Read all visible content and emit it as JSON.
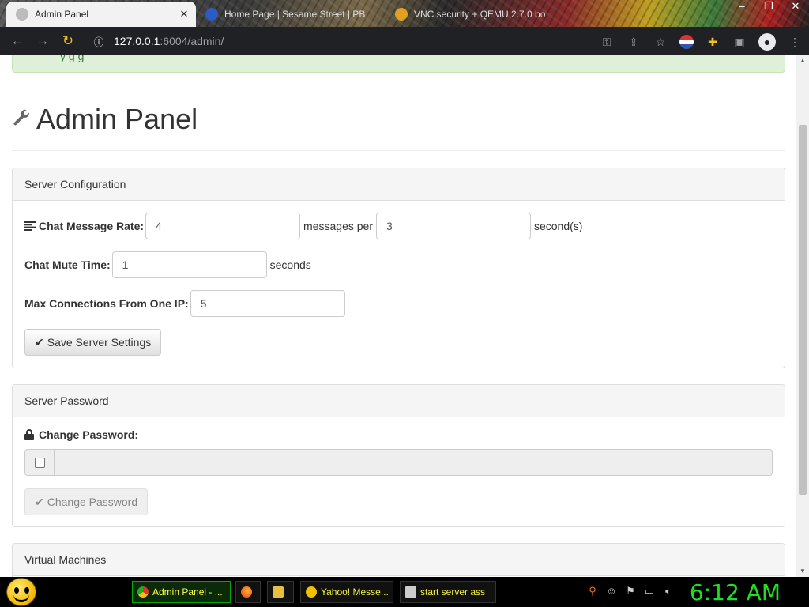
{
  "browser": {
    "tabs": [
      {
        "label": "Admin Panel",
        "active": true
      },
      {
        "label": "Home Page | Sesame Street | PB"
      },
      {
        "label": "VNC security + QEMU 2.7.0 bo"
      }
    ],
    "window_controls": [
      "–",
      "❐",
      "✕"
    ],
    "url_host": "127.0.0.1",
    "url_rest": ":6004/admin/"
  },
  "page": {
    "alert_text": "y      g      g",
    "title": "Admin Panel",
    "server_config": {
      "heading": "Server Configuration",
      "chat_rate_label": "Chat Message Rate:",
      "chat_rate_messages": "4",
      "messages_per": "messages per",
      "chat_rate_seconds": "3",
      "seconds_suffix": "second(s)",
      "mute_label": "Chat Mute Time:",
      "mute_value": "1",
      "mute_suffix": "seconds",
      "max_conn_label": "Max Connections From One IP:",
      "max_conn_value": "5",
      "save_button": "Save Server Settings"
    },
    "server_password": {
      "heading": "Server Password",
      "change_label": "Change Password:",
      "change_button": "Change Password"
    },
    "virtual_machines": {
      "heading": "Virtual Machines"
    }
  },
  "taskbar": {
    "tasks": [
      {
        "label": "Admin Panel - ...",
        "active": true
      },
      {
        "label": ""
      },
      {
        "label": ""
      },
      {
        "label": "Yahoo! Messe..."
      },
      {
        "label": "start server ass"
      }
    ],
    "clock": "6:12 AM"
  },
  "colors": {
    "alert_bg": "#dff0d8",
    "clock": "#1ee01e",
    "task_text": "#f0f040"
  }
}
